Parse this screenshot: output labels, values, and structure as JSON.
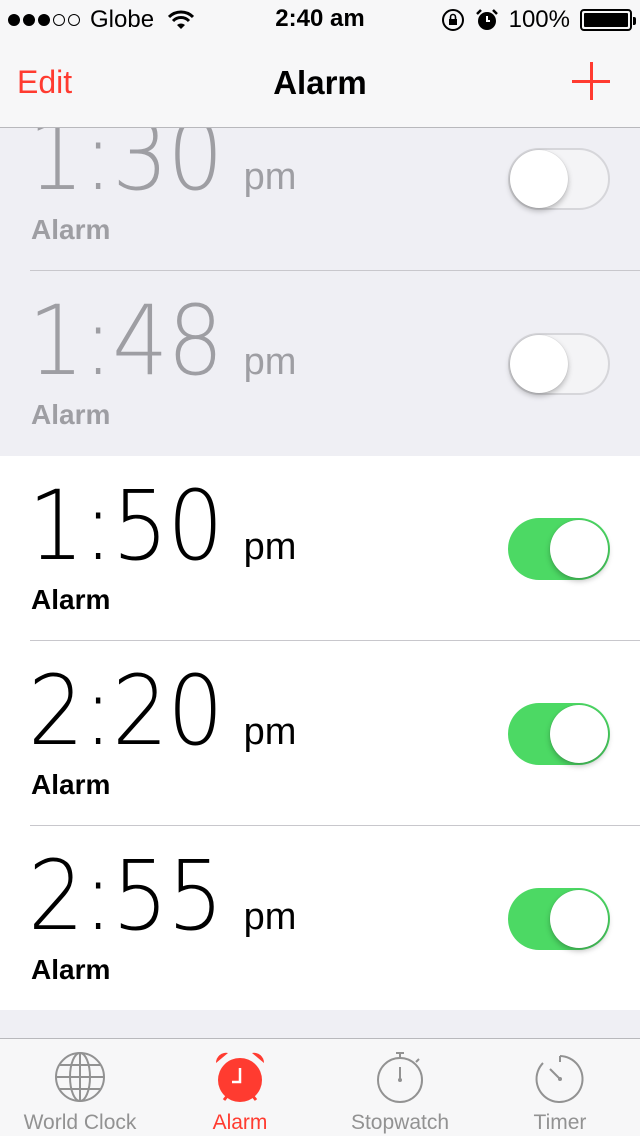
{
  "status_bar": {
    "carrier": "Globe",
    "time": "2:40 am",
    "battery": "100%"
  },
  "nav": {
    "edit_label": "Edit",
    "title": "Alarm"
  },
  "alarms": [
    {
      "time": "1:30",
      "ampm": "pm",
      "label": "Alarm",
      "enabled": false
    },
    {
      "time": "1:48",
      "ampm": "pm",
      "label": "Alarm",
      "enabled": false
    },
    {
      "time": "1:50",
      "ampm": "pm",
      "label": "Alarm",
      "enabled": true
    },
    {
      "time": "2:20",
      "ampm": "pm",
      "label": "Alarm",
      "enabled": true
    },
    {
      "time": "2:55",
      "ampm": "pm",
      "label": "Alarm",
      "enabled": true
    }
  ],
  "tabs": [
    {
      "label": "World Clock",
      "icon": "globe-icon",
      "active": false
    },
    {
      "label": "Alarm",
      "icon": "alarm-clock-icon",
      "active": true
    },
    {
      "label": "Stopwatch",
      "icon": "stopwatch-icon",
      "active": false
    },
    {
      "label": "Timer",
      "icon": "timer-icon",
      "active": false
    }
  ],
  "colors": {
    "accent": "#ff3b30",
    "toggle_on": "#4cd964",
    "inactive": "#929292"
  }
}
